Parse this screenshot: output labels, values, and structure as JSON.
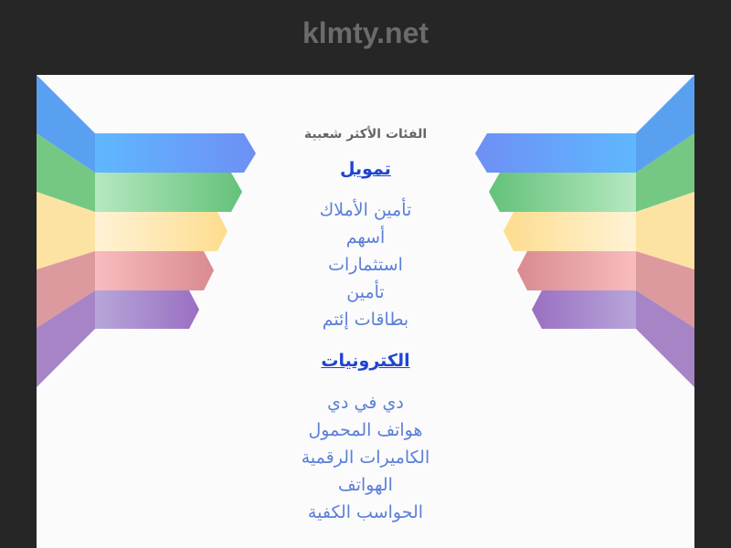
{
  "header": {
    "site_title": "klmty.net"
  },
  "main": {
    "section_heading": "الفئات الأكثر شعبية",
    "categories": [
      {
        "title": "تمويل",
        "links": [
          "تأمين الأملاك",
          "أسهم",
          "استثمارات",
          "تأمين",
          "بطاقات إئتم"
        ]
      },
      {
        "title": "الكترونيات",
        "links": [
          "دي في دي",
          "هواتف المحمول",
          "الكاميرات الرقمية",
          "الهواتف",
          "الحواسب الكفية"
        ]
      }
    ]
  },
  "colors": {
    "page_background": "#262626",
    "panel_background": "#fbfbfb",
    "title_color": "#6b6b6b",
    "category_title": "#1f44d1",
    "category_link": "#5b7fd8",
    "ribbon_blue": "#6aa4f8",
    "ribbon_green": "#7fcf8f",
    "ribbon_yellow": "#fde1a0",
    "ribbon_pink": "#e8a0a3",
    "ribbon_purple": "#a88bcb"
  }
}
